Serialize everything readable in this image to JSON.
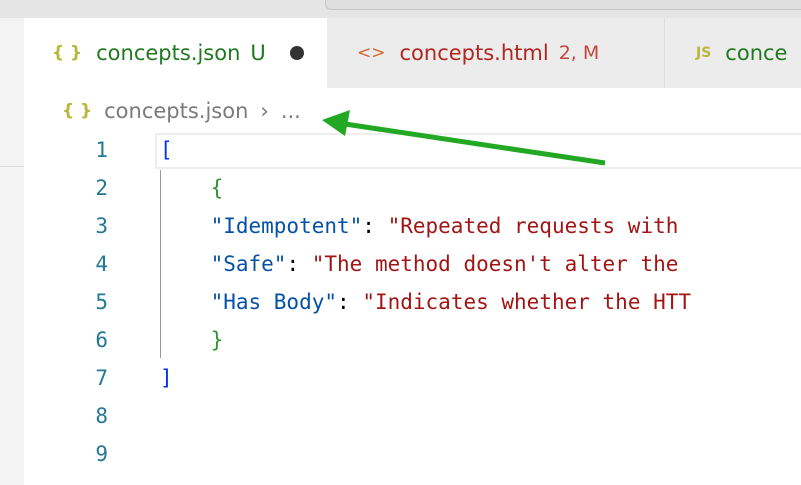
{
  "tabs": [
    {
      "icon": "{ }",
      "label": "concepts.json",
      "badge": "U",
      "dirty": true
    },
    {
      "icon": "<>",
      "label": "concepts.html",
      "badge": "2, M"
    },
    {
      "icon": "JS",
      "label": "conce"
    }
  ],
  "breadcrumb": {
    "icon": "{ }",
    "file": "concepts.json",
    "sep": "›",
    "more": "..."
  },
  "editor": {
    "line_numbers": [
      "1",
      "2",
      "3",
      "4",
      "5",
      "6",
      "7",
      "8",
      "9"
    ],
    "lines": [
      {
        "t": [
          [
            "b1",
            "["
          ]
        ]
      },
      {
        "t": [
          [
            "b2",
            "    {"
          ]
        ]
      },
      {
        "t": [
          [
            "p",
            "    "
          ],
          [
            "k",
            "\"Idempotent\""
          ],
          [
            "p",
            ": "
          ],
          [
            "s",
            "\"Repeated requests with"
          ]
        ]
      },
      {
        "t": [
          [
            "p",
            "    "
          ],
          [
            "k",
            "\"Safe\""
          ],
          [
            "p",
            ": "
          ],
          [
            "s",
            "\"The method doesn't alter the"
          ]
        ]
      },
      {
        "t": [
          [
            "p",
            "    "
          ],
          [
            "k",
            "\"Has Body\""
          ],
          [
            "p",
            ": "
          ],
          [
            "s",
            "\"Indicates whether the HTT"
          ]
        ]
      },
      {
        "t": [
          [
            "b2",
            "    }"
          ]
        ]
      },
      {
        "t": [
          [
            "b1",
            "]"
          ]
        ]
      },
      {
        "t": []
      },
      {
        "t": []
      }
    ]
  },
  "annotation": {
    "color": "#22a822",
    "type": "arrow"
  }
}
